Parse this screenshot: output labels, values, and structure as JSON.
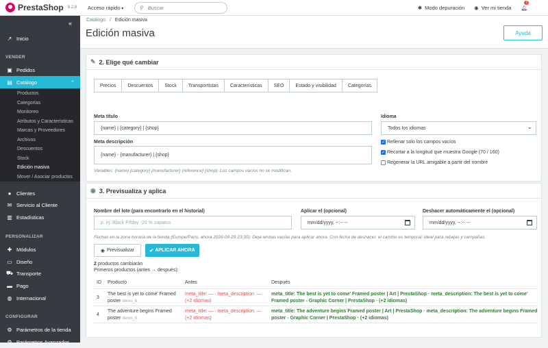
{
  "topbar": {
    "brand": "PrestaShop",
    "version": "8.2.8",
    "quick_access": "Acceso rápido",
    "search_placeholder": "Buscar",
    "debug_mode": "Modo depuración",
    "view_store": "Ver mi tienda",
    "notifications_count": "7"
  },
  "sidebar": {
    "inicio": "Inicio",
    "sec_vender": "VENDER",
    "pedidos": "Pedidos",
    "catalogo": "Catálogo",
    "sub": [
      "Productos",
      "Categorías",
      "Monitoreo",
      "Atributos y Características",
      "Marcas y Proveedores",
      "Archivos",
      "Descuentos",
      "Stock",
      "Edición masiva",
      "Mover / Asociar productos"
    ],
    "clientes": "Clientes",
    "servicio": "Servicio al Cliente",
    "estadisticas": "Estadísticas",
    "sec_personalizar": "PERSONALIZAR",
    "modulos": "Módulos",
    "diseno": "Diseño",
    "transporte": "Transporte",
    "pago": "Pago",
    "internacional": "Internacional",
    "sec_configurar": "CONFIGURAR",
    "parametros_tienda": "Parámetros de la tienda",
    "parametros_avanzados": "Parámetros Avanzados"
  },
  "header": {
    "breadcrumb_parent": "Catálogo",
    "breadcrumb_sep": "/",
    "breadcrumb_current": "Edición masiva",
    "title": "Edición masiva",
    "help": "Ayuda"
  },
  "step2": {
    "title": "2. Elige qué cambiar",
    "tabs": [
      "Precios",
      "Descuentos",
      "Stock",
      "Transportistas",
      "Características",
      "SEO",
      "Estado y visibilidad",
      "Categorías"
    ],
    "meta_title_label": "Meta título",
    "meta_title_value": "{name} | {category} | {shop}",
    "meta_desc_label": "Meta descripción",
    "meta_desc_value": "{name} - {manufacturer} | {shop}",
    "lang_label": "Idioma",
    "lang_value": "Todos los idiomas",
    "chk_fill_empty": "Rellenar solo los campos vacíos",
    "chk_trim": "Recortar a la longitud que muestra Google (70 / 160)",
    "chk_regen": "Regenerar la URL amigable a partir del nombre",
    "variables_hint": "Variables: {name} {category} {manufacturer} {reference} {shop}. Los campos vacíos no se modifican."
  },
  "step3": {
    "title": "3. Previsualiza y aplica",
    "batch_label": "Nombre del lote (para encontrarlo en el historial)",
    "batch_placeholder": "p. ej. Black Friday -20 % zapatos",
    "apply_label": "Aplicar el (opcional)",
    "apply_value": "mm/dd/yyyy, --:-- --",
    "undo_label": "Deshacer automáticamente el (opcional)",
    "undo_value": "mm/dd/yyyy, --:-- --",
    "dates_hint": "Fechas en la zona horaria de la tienda (Europe/Paris, ahora 2026-09-29 23:35). Deja ambas vacías para aplicar ahora. Con fecha de deshacer, el cambio es temporal: ideal para rebajas y campañas.",
    "preview_btn": "Previsualizar",
    "apply_btn": "APLICAR AHORA",
    "summary_count": "2",
    "summary_rest": " productos cambiarán",
    "summary_sub": "Primeros productos (antes → después):",
    "col_id": "ID",
    "col_product": "Producto",
    "col_before": "Antes",
    "col_after": "Después",
    "rows": [
      {
        "id": "3",
        "name1": "The best is yet to come' Framed",
        "name2": "poster",
        "ref": "demo_6",
        "before1": "meta_title: — · meta_description: —",
        "before2": "(+2 idiomas)",
        "after1": "meta_title: The best is yet to come' Framed poster | Art | PrestaShop · meta_description: The best is yet to come'",
        "after2": "Framed poster - Graphic Corner | PrestaShop · (+2 idiomas)"
      },
      {
        "id": "4",
        "name1": "The adventure begins Framed",
        "name2": "poster",
        "ref": "demo_5",
        "before1": "meta_title: — · meta_description: —",
        "before2": "(+2 idiomas)",
        "after1": "meta_title: The adventure begins Framed poster | Art | PrestaShop · meta_description: The adventure begins Framed",
        "after2": "poster - Graphic Corner | PrestaShop · (+2 idiomas)"
      }
    ]
  }
}
